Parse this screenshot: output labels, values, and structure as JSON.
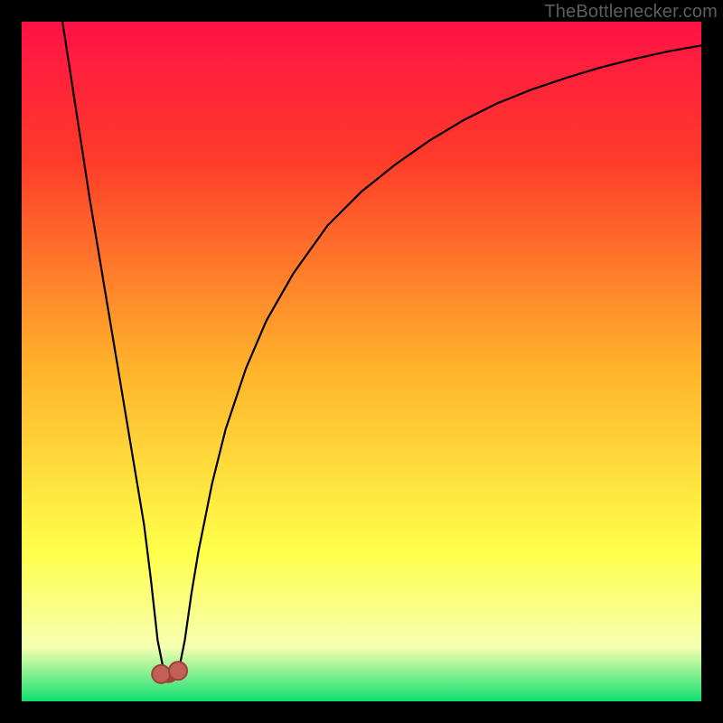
{
  "watermark": "TheBottlenecker.com",
  "colors": {
    "bg": "#000000",
    "gradient_top": "#ff1246",
    "gradient_upper": "#ff3a2a",
    "gradient_mid": "#ffb02a",
    "gradient_lower": "#ffff4a",
    "gradient_pale": "#f6ffb0",
    "gradient_green": "#10e070",
    "curve": "#000000",
    "marker_fill": "#c06058",
    "marker_stroke": "#a04038"
  },
  "chart_data": {
    "type": "line",
    "title": "",
    "xlabel": "",
    "ylabel": "",
    "xlim": [
      0,
      100
    ],
    "ylim": [
      0,
      100
    ],
    "series": [
      {
        "name": "bottleneck-curve",
        "x": [
          6,
          8,
          10,
          12,
          14,
          16,
          18,
          19,
          20,
          21,
          22,
          23,
          24,
          25,
          26,
          28,
          30,
          33,
          36,
          40,
          45,
          50,
          55,
          60,
          65,
          70,
          75,
          80,
          85,
          90,
          95,
          100
        ],
        "values": [
          100,
          87,
          74,
          62,
          50,
          38,
          26,
          18,
          9,
          4,
          3,
          4,
          9,
          16,
          22,
          32,
          40,
          49,
          56,
          63,
          70,
          75,
          79,
          82.5,
          85.5,
          88,
          90,
          91.7,
          93.2,
          94.5,
          95.6,
          96.5
        ]
      }
    ],
    "markers": [
      {
        "x": 20.5,
        "y": 4
      },
      {
        "x": 23.0,
        "y": 4.5
      }
    ],
    "marker_link": {
      "from": 0,
      "to": 1,
      "dip_y": 2.5
    }
  }
}
